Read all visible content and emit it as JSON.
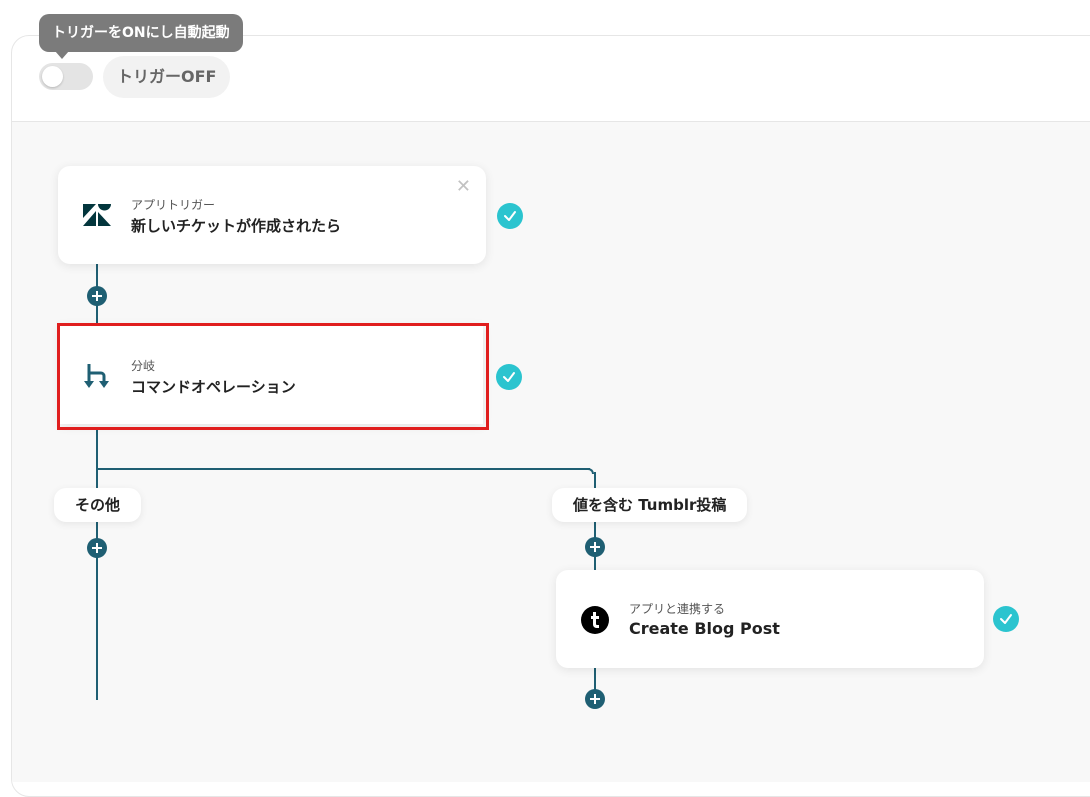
{
  "header": {
    "tooltip": "トリガーをONにし自動起動",
    "trigger_status": "トリガーOFF",
    "toggle_on": false
  },
  "flow": {
    "trigger": {
      "subtitle": "アプリトリガー",
      "title": "新しいチケットが作成されたら",
      "icon": "zendesk-icon"
    },
    "branch_step": {
      "subtitle": "分岐",
      "title": "コマンドオペレーション",
      "icon": "branch-icon"
    },
    "branches": [
      {
        "label": "その他"
      },
      {
        "label": "値を含む Tumblr投稿"
      }
    ],
    "action": {
      "subtitle": "アプリと連携する",
      "title": "Create Blog Post",
      "icon": "tumblr-icon"
    }
  },
  "colors": {
    "connector": "#1f5f73",
    "check": "#2bc4cf",
    "highlight": "#e01e1e"
  }
}
